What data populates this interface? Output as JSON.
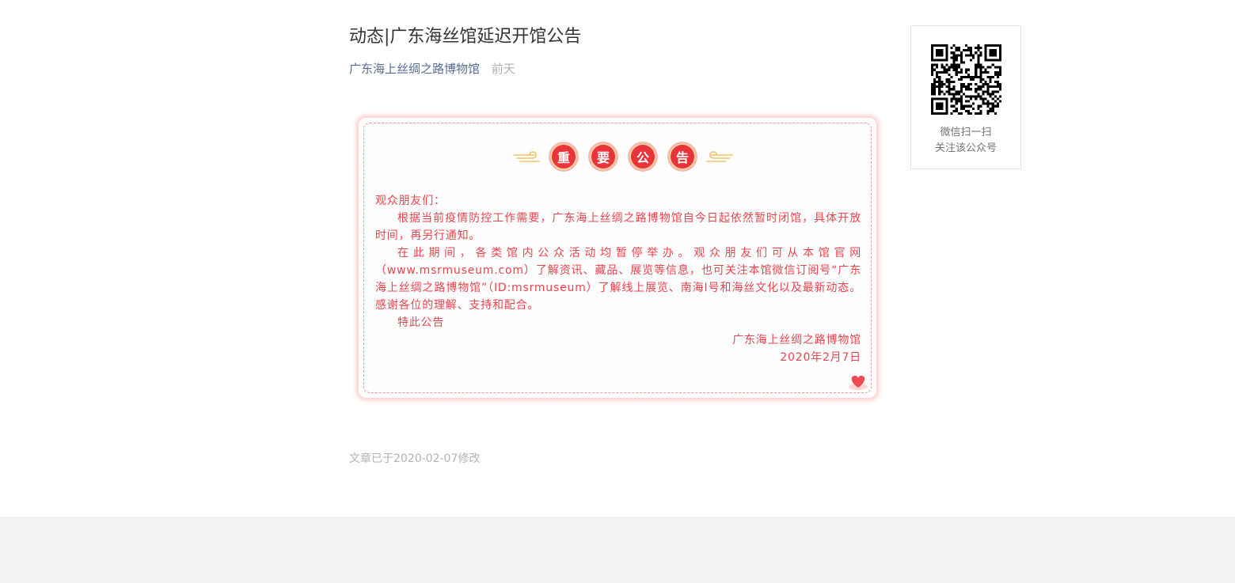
{
  "article": {
    "title": "动态|广东海丝馆延迟开馆公告",
    "author": "广东海上丝绸之路博物馆",
    "time": "前天",
    "modified_note": "文章已于2020-02-07修改"
  },
  "notice": {
    "banner_chars": [
      "重",
      "要",
      "公",
      "告"
    ],
    "greeting": "观众朋友们：",
    "paragraph1": "根据当前疫情防控工作需要，广东海上丝绸之路博物馆自今日起依然暂时闭馆，具体开放时间，再另行通知。",
    "paragraph2": "在此期间，各类馆内公众活动均暂停举办。观众朋友们可从本馆官网（www.msrmuseum.com）了解资讯、藏品、展览等信息，也可关注本馆微信订阅号“广东海上丝绸之路博物馆”（ID:msrmuseum）了解线上展览、南海I号和海丝文化以及最新动态。感谢各位的理解、支持和配合。",
    "closing": "特此公告",
    "signature": "广东海上丝绸之路博物馆",
    "date": "2020年2月7日",
    "colors": {
      "text": "#e8434b",
      "seal": "#e8343a",
      "accent": "#f2c26b"
    }
  },
  "qr": {
    "caption_line1": "微信扫一扫",
    "caption_line2": "关注该公众号"
  },
  "icons": [
    "qr-code-icon",
    "cloud-ornament-icon",
    "heart-icon"
  ]
}
